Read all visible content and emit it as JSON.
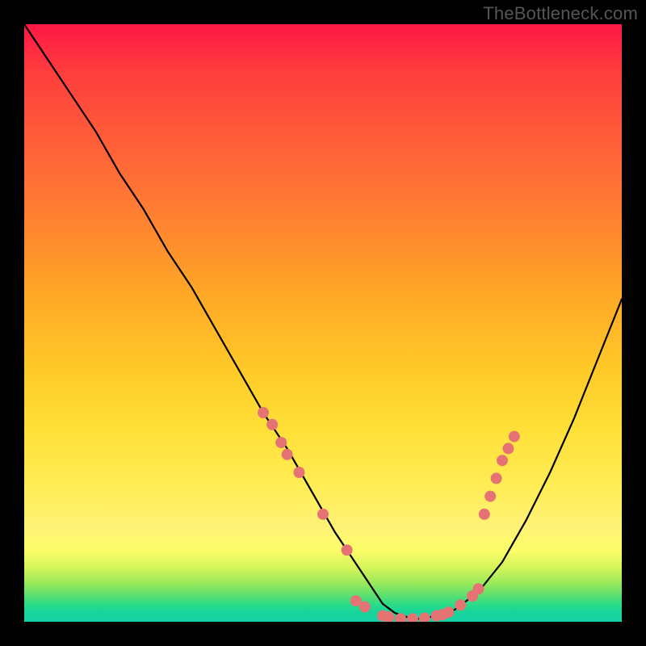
{
  "watermark": "TheBottleneck.com",
  "chart_data": {
    "type": "line",
    "title": "",
    "xlabel": "",
    "ylabel": "",
    "xlim": [
      0,
      100
    ],
    "ylim": [
      0,
      100
    ],
    "series": [
      {
        "name": "curve",
        "x": [
          0,
          4,
          8,
          12,
          16,
          20,
          24,
          28,
          32,
          36,
          40,
          44,
          48,
          52,
          56,
          58,
          60,
          62,
          64,
          66,
          68,
          72,
          76,
          80,
          84,
          88,
          92,
          96,
          100
        ],
        "y": [
          100,
          94,
          88,
          82,
          75,
          69,
          62,
          56,
          49,
          42,
          35,
          29,
          22,
          15,
          9,
          6,
          3,
          1.5,
          0.8,
          0.5,
          0.8,
          2,
          5,
          10,
          17,
          25,
          34,
          44,
          54
        ]
      }
    ],
    "markers": {
      "name": "highlighted-points",
      "color": "#e57373",
      "points": [
        {
          "x": 40,
          "y": 35
        },
        {
          "x": 41.5,
          "y": 33
        },
        {
          "x": 43,
          "y": 30
        },
        {
          "x": 44,
          "y": 28
        },
        {
          "x": 46,
          "y": 25
        },
        {
          "x": 50,
          "y": 18
        },
        {
          "x": 54,
          "y": 12
        },
        {
          "x": 55.5,
          "y": 3.5
        },
        {
          "x": 57,
          "y": 2.5
        },
        {
          "x": 60,
          "y": 1
        },
        {
          "x": 61,
          "y": 0.8
        },
        {
          "x": 63,
          "y": 0.5
        },
        {
          "x": 65,
          "y": 0.5
        },
        {
          "x": 67,
          "y": 0.6
        },
        {
          "x": 69,
          "y": 1
        },
        {
          "x": 70,
          "y": 1.2
        },
        {
          "x": 71,
          "y": 1.6
        },
        {
          "x": 73,
          "y": 2.8
        },
        {
          "x": 75,
          "y": 4.3
        },
        {
          "x": 76,
          "y": 5.5
        },
        {
          "x": 77,
          "y": 18
        },
        {
          "x": 78,
          "y": 21
        },
        {
          "x": 79,
          "y": 24
        },
        {
          "x": 80,
          "y": 27
        },
        {
          "x": 81,
          "y": 29
        },
        {
          "x": 82,
          "y": 31
        }
      ]
    }
  }
}
